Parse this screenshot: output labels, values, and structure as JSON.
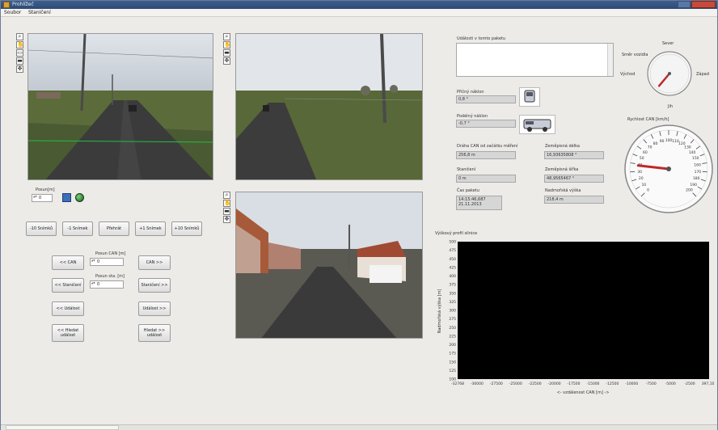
{
  "window": {
    "title": "Prohlížeč"
  },
  "menu": [
    "Soubor",
    "Staničení"
  ],
  "controls": {
    "posun_label": "Posun[m]",
    "posun_value": "0",
    "frame_buttons": [
      "-10 Snímků",
      "-1 Snímek",
      "Přehrát",
      "+1 Snímek",
      "+10 Snímků"
    ],
    "can_prev": "<< CAN",
    "can_next": "CAN >>",
    "posun_can_label": "Posun CAN [m]",
    "posun_can_value": "0",
    "stanic_prev": "<< Staničení",
    "stanic_next": "Staničení >>",
    "posun_sta_label": "Posun sta. [m]",
    "posun_sta_value": "0",
    "udalost_prev": "<< Událost",
    "udalost_next": "Událost >>",
    "hledat_prev": "<< Hledat událost",
    "hledat_next": "Hledat >> událost"
  },
  "info": {
    "udalosti_label": "Události v tomto paketu",
    "pricny_label": "Příčný náklon",
    "pricny_value": "0,8 °",
    "podelny_label": "Podélný náklon",
    "podelny_value": "-0,7 °",
    "draha_label": "Dráha CAN od začátku měření",
    "draha_value": "256,8 m",
    "delka_label": "Zeměpisná délka",
    "delka_value": "16,93635808 °",
    "staniceni_label": "Staničení",
    "staniceni_value": "0 m",
    "sirka_label": "Zeměpisná šířka",
    "sirka_value": "48,9565467 °",
    "cas_label": "Čas paketu",
    "cas_time": "14:15:46,687",
    "cas_date": "21.11.2013",
    "vyska_label": "Nadmořská výška",
    "vyska_value": "218,4 m"
  },
  "compass": {
    "label": "Směr vozidla",
    "north": "Sever",
    "east": "Východ",
    "west": "Západ",
    "south": "Jih",
    "heading_deg": 220
  },
  "speedo": {
    "label": "Rychlost CAN [km/h]",
    "min": 0,
    "max": 200,
    "ticks": [
      "0",
      "10",
      "20",
      "30",
      "40",
      "50",
      "60",
      "70",
      "80",
      "90",
      "100",
      "110",
      "120",
      "130",
      "140",
      "150",
      "160",
      "170",
      "180",
      "190",
      "200"
    ],
    "value": 38
  },
  "chart_data": {
    "type": "line",
    "title": "Výškový profil silnice",
    "ylabel": "Nadmořská výška [m]",
    "xlabel": "<- vzdálenost CAN [m] ->",
    "ylim": [
      100,
      500
    ],
    "xlim": [
      -32768,
      397.104
    ],
    "yticks": [
      "500",
      "475",
      "450",
      "425",
      "400",
      "375",
      "350",
      "325",
      "300",
      "275",
      "250",
      "225",
      "200",
      "175",
      "150",
      "125",
      "100"
    ],
    "xticks": [
      "-32768",
      "-30000",
      "-27500",
      "-25000",
      "-22500",
      "-20000",
      "-17500",
      "-15000",
      "-12500",
      "-10000",
      "-7500",
      "-5000",
      "-2500",
      "397,104"
    ],
    "series": [],
    "background": "#000000"
  }
}
